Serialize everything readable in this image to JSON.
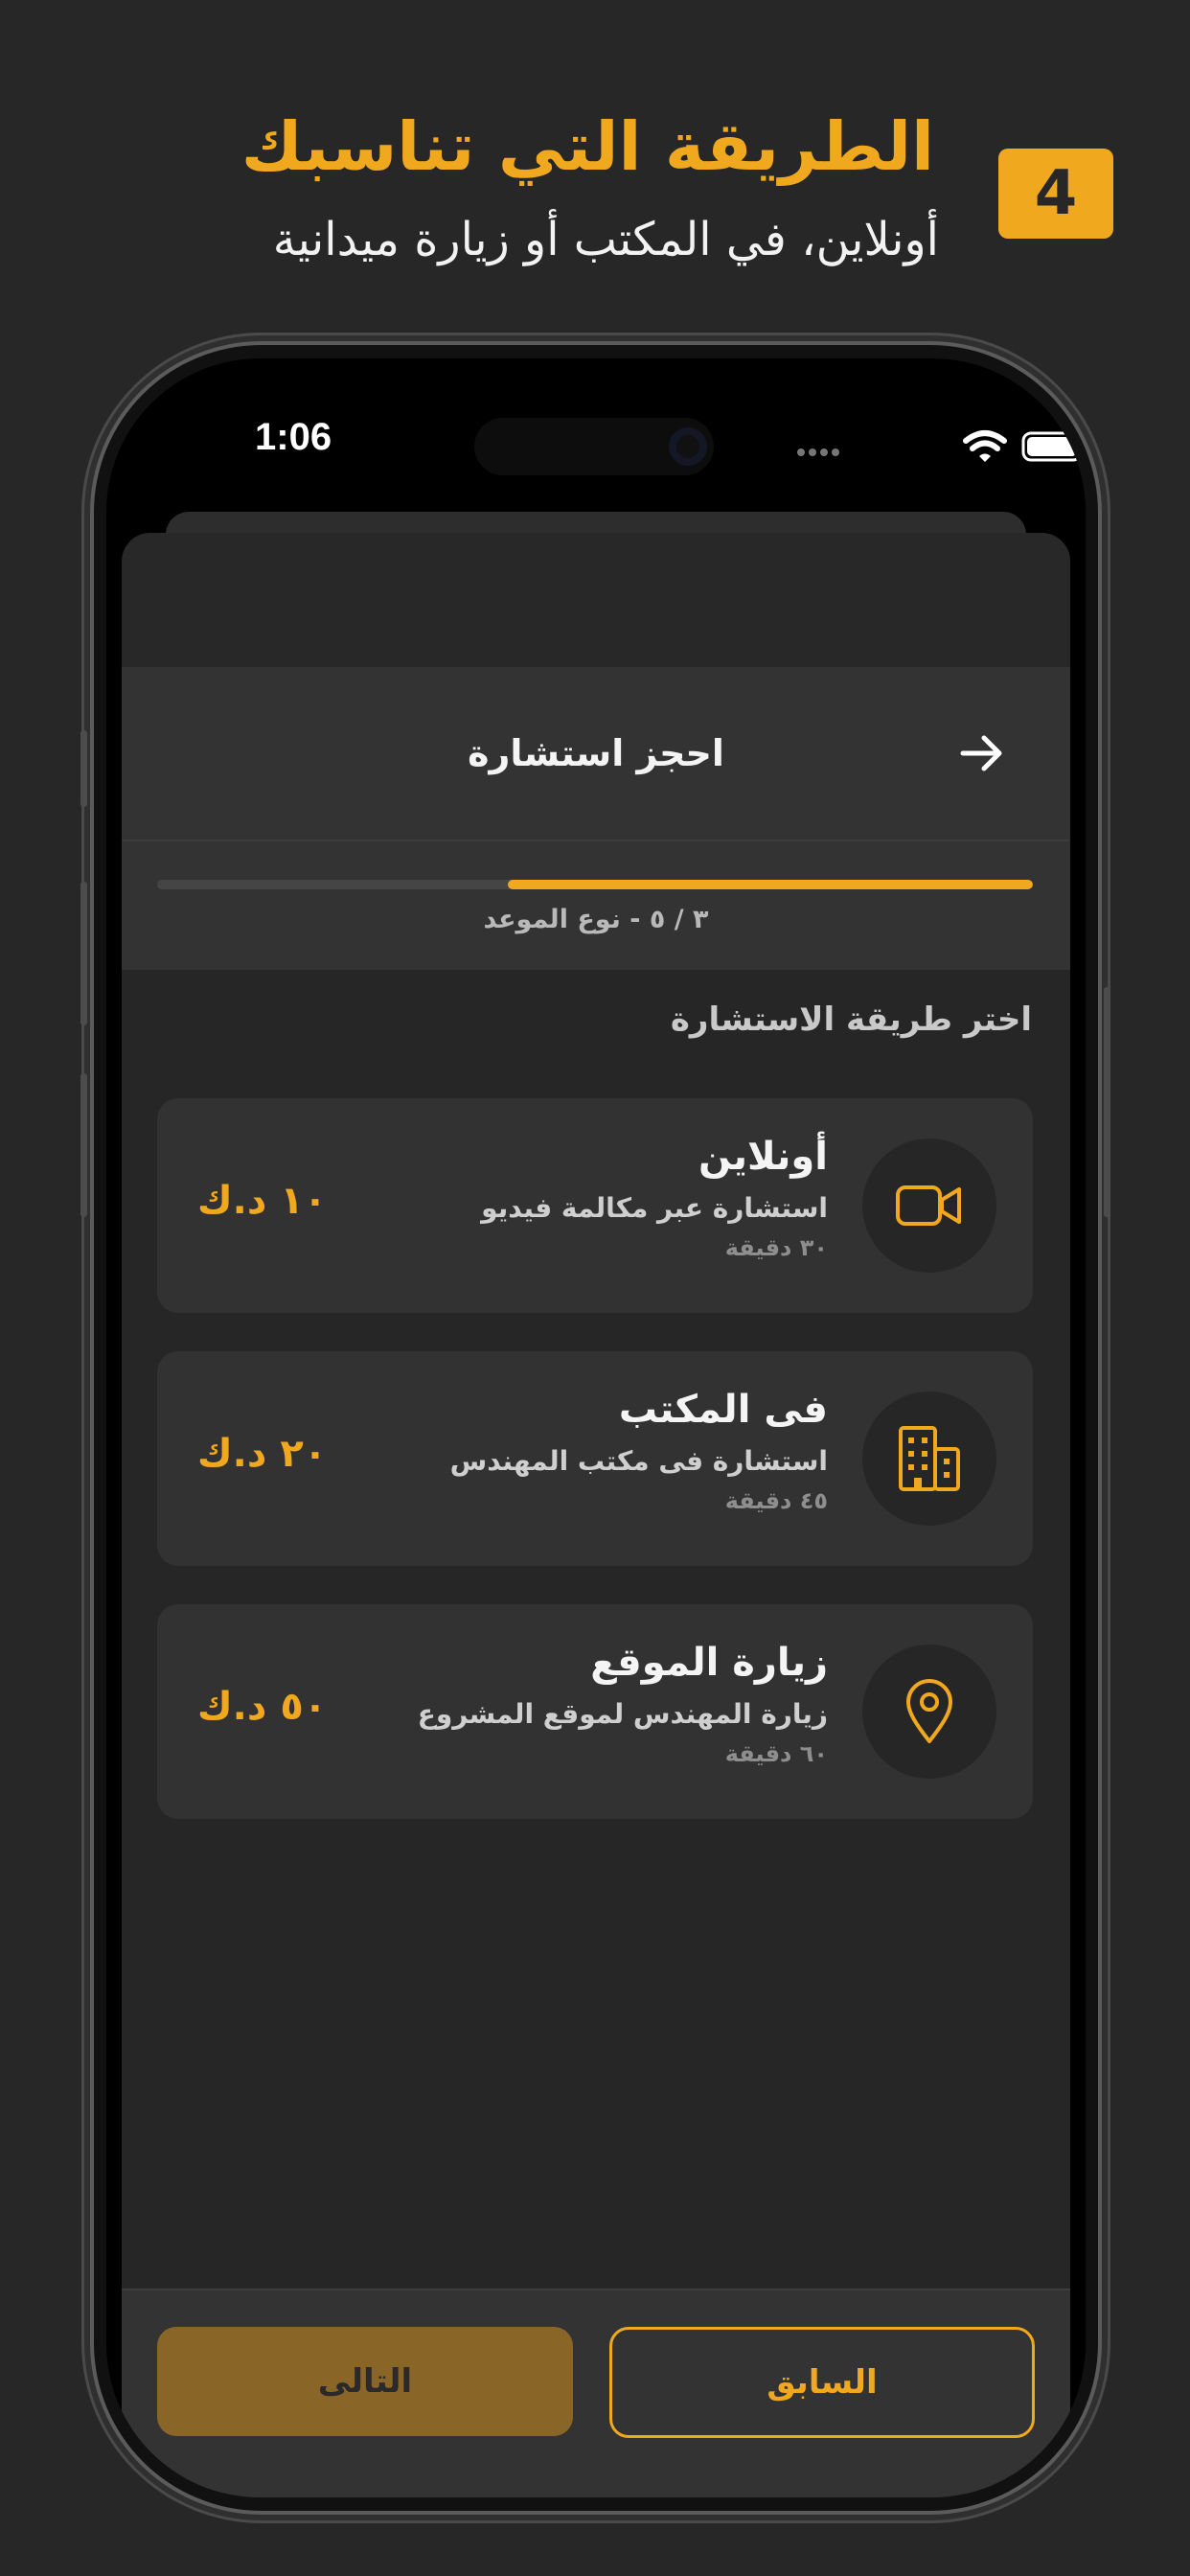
{
  "promo": {
    "title": "الطريقة التي تناسبك",
    "subtitle": "أونلاين، في المكتب أو زيارة ميدانية",
    "step_number": "4"
  },
  "status_bar": {
    "time": "1:06",
    "icons": [
      "signal-dots-icon",
      "wifi-icon",
      "battery-icon"
    ]
  },
  "nav": {
    "title": "احجز استشارة",
    "back_icon": "arrow-right-icon"
  },
  "progress": {
    "current": 3,
    "total": 5,
    "fraction": 0.6,
    "label": "٣ / ٥ - نوع الموعد"
  },
  "section_title": "اختر طريقة الاستشارة",
  "options": [
    {
      "icon": "video-camera-icon",
      "title": "أونلاين",
      "description": "استشارة عبر مكالمة فيديو",
      "duration": "٣٠ دقيقة",
      "price": "١٠ د.ك"
    },
    {
      "icon": "building-icon",
      "title": "فى المكتب",
      "description": "استشارة فى مكتب المهندس",
      "duration": "٤٥ دقيقة",
      "price": "٢٠ د.ك"
    },
    {
      "icon": "map-pin-icon",
      "title": "زيارة الموقع",
      "description": "زيارة المهندس لموقع المشروع",
      "duration": "٦٠ دقيقة",
      "price": "٥٠ د.ك"
    }
  ],
  "buttons": {
    "next": "التالى",
    "previous": "السابق"
  },
  "colors": {
    "accent": "#f0a81f",
    "background": "#272727",
    "card": "#323232",
    "next_disabled": "#8a6528"
  }
}
